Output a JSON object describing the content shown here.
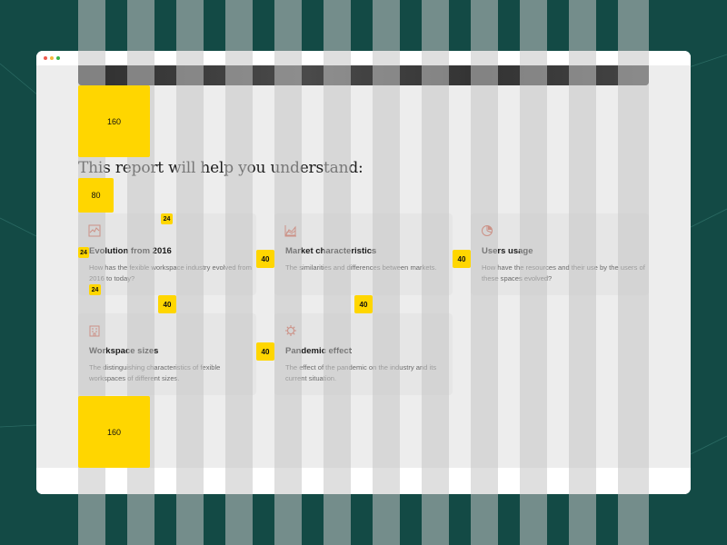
{
  "hero_image": "dark-banner-photo",
  "report": {
    "heading": "This report will help you understand:",
    "cards": [
      {
        "icon": "line-chart-icon",
        "title": "Evolution from 2016",
        "description": "How has the fexible workspace industry evolved from 2016 to today?"
      },
      {
        "icon": "area-chart-icon",
        "title": "Market characteristics",
        "description": "The similarities and differences between markets."
      },
      {
        "icon": "pie-chart-icon",
        "title": "Users usage",
        "description": "How have the resources and their use by the users of these spaces evolved?"
      },
      {
        "icon": "building-icon",
        "title": "Workspace sizes",
        "description": "The distinguishing characteristics of fexible workspaces of different sizes."
      },
      {
        "icon": "virus-icon",
        "title": "Pandemic effect",
        "description": "The effect of the pandemic on the industry and its current situation."
      }
    ]
  },
  "spacing_annotations": {
    "top_spacer": "160",
    "heading_gap": "80",
    "card_gap_a": "24",
    "card_gap_b": "24",
    "card_gap_c": "24",
    "column_gap_1": "40",
    "column_gap_2": "40",
    "column_gap_3": "40",
    "row_gap_1": "40",
    "row_gap_2": "40",
    "bottom_spacer": "160"
  },
  "colors": {
    "background": "#134a45",
    "grid_column": "#c4c4c4",
    "annotation": "#ffd600",
    "icon_accent": "#d6533a"
  }
}
